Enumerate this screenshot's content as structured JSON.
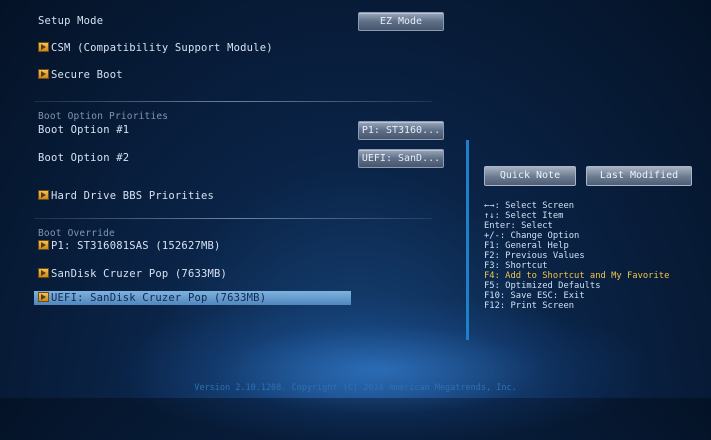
{
  "settings": {
    "setup_mode_label": "Setup Mode",
    "setup_mode_value": "EZ Mode",
    "csm_label": "CSM (Compatibility Support Module)",
    "secure_boot_label": "Secure Boot",
    "boot_priorities_header": "Boot Option Priorities",
    "boot_option_1_label": "Boot Option #1",
    "boot_option_1_value": "P1: ST3160...",
    "boot_option_2_label": "Boot Option #2",
    "boot_option_2_value": "UEFI: SanD...",
    "hdd_bbs_label": "Hard Drive BBS Priorities",
    "boot_override_header": "Boot Override",
    "override_1_label": "P1: ST316081SAS (152627MB)",
    "override_2_label": "SanDisk Cruzer Pop (7633MB)",
    "override_3_label": "UEFI: SanDisk Cruzer Pop (7633MB)"
  },
  "side": {
    "quick_note_label": "Quick Note",
    "last_modified_label": "Last Modified"
  },
  "help": {
    "line1": "←→: Select Screen",
    "line2": "↑↓: Select Item",
    "line3": "Enter: Select",
    "line4": "+/-: Change Option",
    "line5": "F1: General Help",
    "line6": "F2: Previous Values",
    "line7": "F3: Shortcut",
    "line8": "F4: Add to Shortcut and My Favorite",
    "line9": "F5: Optimized Defaults",
    "line10": "F10: Save  ESC: Exit",
    "line11": "F12: Print Screen"
  },
  "footer": {
    "text": "Version 2.10.1208. Copyright (C) 2014 American Megatrends, Inc."
  },
  "colors": {
    "highlight": "#f3c34a",
    "selection": "#5f96cc",
    "background": "#0a2346"
  },
  "icons": {
    "item_arrow": "arrow-right-icon"
  }
}
